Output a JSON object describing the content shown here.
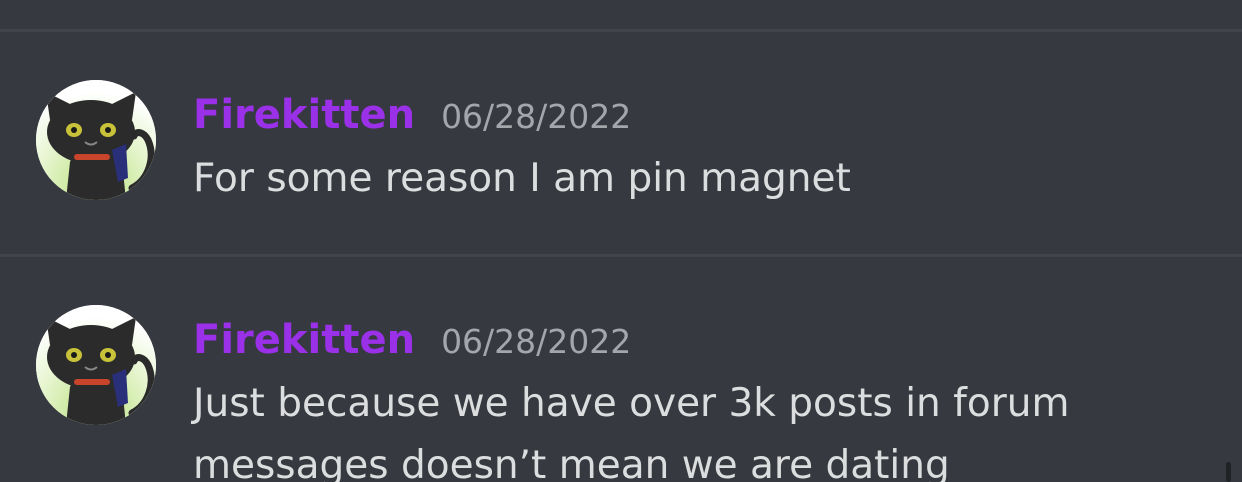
{
  "messages": [
    {
      "username": "Firekitten",
      "timestamp": "06/28/2022",
      "content": "For some reason I am pin magnet",
      "avatar_icon": "black-cat-avatar-icon"
    },
    {
      "username": "Firekitten",
      "timestamp": "06/28/2022",
      "content": "Just because we have over 3k posts in forum messages doesn’t mean we are dating",
      "avatar_icon": "black-cat-avatar-icon"
    }
  ],
  "colors": {
    "background": "#36393f",
    "divider": "#41444a",
    "username": "#9a30e8",
    "timestamp": "#a3a6aa",
    "message_text": "#dcddde"
  }
}
